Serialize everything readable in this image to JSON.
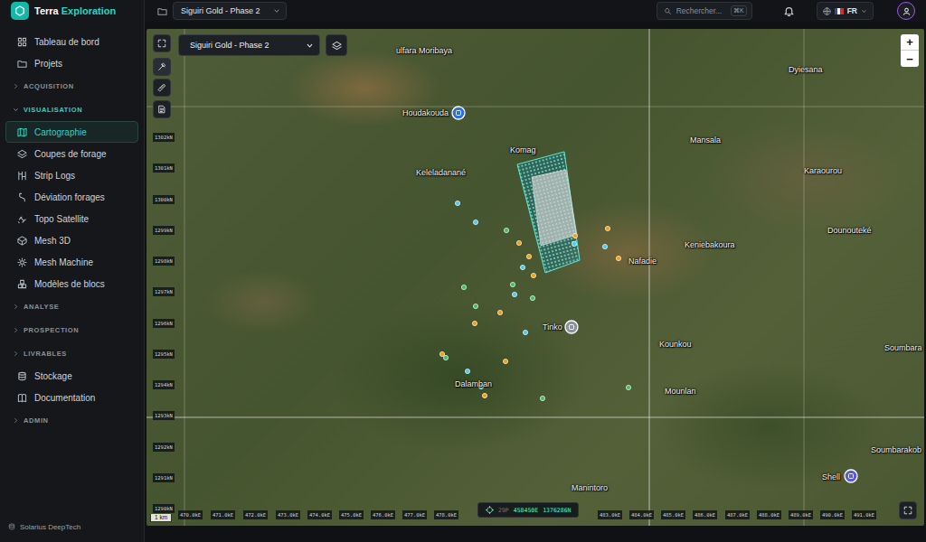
{
  "brand": {
    "name_a": "Terra",
    "name_b": "Exploration"
  },
  "topbar": {
    "project": "Siguiri Gold - Phase 2",
    "search_placeholder": "Rechercher...",
    "shortcut": "⌘K",
    "language": "FR"
  },
  "sidebar": {
    "items": [
      {
        "kind": "item",
        "label": "Tableau de bord",
        "selected": false
      },
      {
        "kind": "item",
        "label": "Projets",
        "selected": false
      },
      {
        "kind": "section",
        "label": "ACQUISITION",
        "expanded": false
      },
      {
        "kind": "section",
        "label": "VISUALISATION",
        "expanded": true
      },
      {
        "kind": "item",
        "label": "Cartographie",
        "selected": true
      },
      {
        "kind": "item",
        "label": "Coupes de forage",
        "selected": false
      },
      {
        "kind": "item",
        "label": "Strip Logs",
        "selected": false
      },
      {
        "kind": "item",
        "label": "Déviation forages",
        "selected": false
      },
      {
        "kind": "item",
        "label": "Topo Satellite",
        "selected": false
      },
      {
        "kind": "item",
        "label": "Mesh 3D",
        "selected": false
      },
      {
        "kind": "item",
        "label": "Mesh Machine",
        "selected": false
      },
      {
        "kind": "item",
        "label": "Modèles de blocs",
        "selected": false
      },
      {
        "kind": "section",
        "label": "ANALYSE",
        "expanded": false
      },
      {
        "kind": "section",
        "label": "PROSPECTION",
        "expanded": false
      },
      {
        "kind": "section",
        "label": "LIVRABLES",
        "expanded": false
      },
      {
        "kind": "item",
        "label": "Stockage",
        "selected": false
      },
      {
        "kind": "item",
        "label": "Documentation",
        "selected": false
      },
      {
        "kind": "section",
        "label": "ADMIN",
        "expanded": false
      }
    ],
    "footer": "Solarius DeepTech"
  },
  "map": {
    "layer_select": "Siguiri Gold - Phase 2",
    "zoom_in": "+",
    "zoom_out": "−",
    "places": [
      {
        "label": "ulfara Moribaya"
      },
      {
        "label": "Houdakouda"
      },
      {
        "label": "Keleladanané"
      },
      {
        "label": "Komag"
      },
      {
        "label": "Mansala"
      },
      {
        "label": "Dyiesana"
      },
      {
        "label": "Karaourou"
      },
      {
        "label": "Dounouteké"
      },
      {
        "label": "Keniebakoura"
      },
      {
        "label": "Nafadie"
      },
      {
        "label": "Tinko"
      },
      {
        "label": "Kounkou"
      },
      {
        "label": "Soumbara"
      },
      {
        "label": "Dalamban"
      },
      {
        "label": "Mounlan"
      },
      {
        "label": "Manintoro"
      },
      {
        "label": "Soumbarakob"
      },
      {
        "label": "Shell"
      }
    ],
    "northing_ticks": [
      "1302kN",
      "1301kN",
      "1300kN",
      "1299kN",
      "1298kN",
      "1297kN",
      "1296kN",
      "1295kN",
      "1294kN",
      "1293kN",
      "1292kN",
      "1291kN",
      "1290kN"
    ],
    "easting_ticks": [
      "470.0kE",
      "471.0kE",
      "472.0kE",
      "473.0kE",
      "474.0kE",
      "475.0kE",
      "476.0kE",
      "477.0kE",
      "478.0kE",
      "483.0kE",
      "484.0kE",
      "485.0kE",
      "486.0kE",
      "487.0kE",
      "488.0kE",
      "489.0kE",
      "490.0kE",
      "491.0kE"
    ],
    "scale": "1 km",
    "coordinates": {
      "zone": "29P",
      "easting": "458450E",
      "northing": "1376286N"
    },
    "drill_holes": [
      {
        "color": "#4cc9f0"
      },
      {
        "color": "#4cc9f0"
      },
      {
        "color": "#3fbf6a"
      },
      {
        "color": "#f59e0b"
      },
      {
        "color": "#f59e0b"
      },
      {
        "color": "#4cc9f0"
      },
      {
        "color": "#3fbf6a"
      },
      {
        "color": "#f59e0b"
      },
      {
        "color": "#3fbf6a"
      },
      {
        "color": "#4cc9f0"
      },
      {
        "color": "#3fbf6a"
      },
      {
        "color": "#3fbf6a"
      },
      {
        "color": "#f59e0b"
      },
      {
        "color": "#f59e0b"
      },
      {
        "color": "#4cc9f0"
      },
      {
        "color": "#f59e0b"
      },
      {
        "color": "#3fbf6a"
      },
      {
        "color": "#f59e0b"
      },
      {
        "color": "#4cc9f0"
      },
      {
        "color": "#4cc9f0"
      },
      {
        "color": "#f59e0b"
      },
      {
        "color": "#3fbf6a"
      },
      {
        "color": "#3fbf6a"
      },
      {
        "color": "#f59e0b"
      },
      {
        "color": "#4cc9f0"
      },
      {
        "color": "#f59e0b"
      },
      {
        "color": "#f59e0b"
      },
      {
        "color": "#4cc9f0"
      }
    ]
  }
}
